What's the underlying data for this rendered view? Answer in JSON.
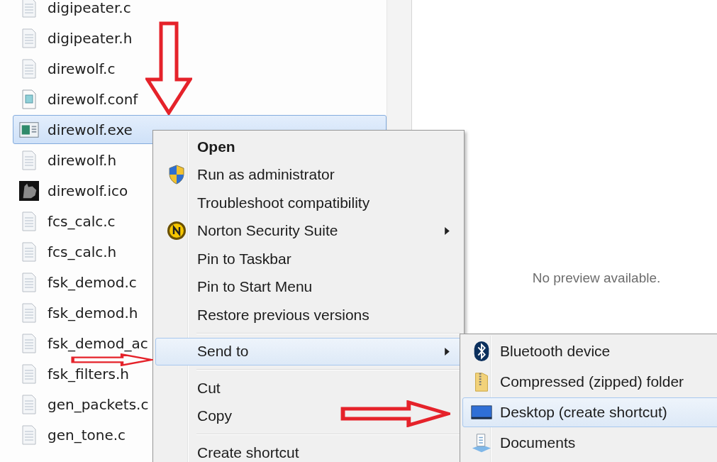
{
  "files": [
    {
      "name": "digipeater.c",
      "kind": "text",
      "selected": false
    },
    {
      "name": "digipeater.h",
      "kind": "text",
      "selected": false
    },
    {
      "name": "direwolf.c",
      "kind": "text",
      "selected": false
    },
    {
      "name": "direwolf.conf",
      "kind": "config",
      "selected": false
    },
    {
      "name": "direwolf.exe",
      "kind": "exe",
      "selected": true
    },
    {
      "name": "direwolf.h",
      "kind": "text",
      "selected": false
    },
    {
      "name": "direwolf.ico",
      "kind": "ico",
      "selected": false
    },
    {
      "name": "fcs_calc.c",
      "kind": "text",
      "selected": false
    },
    {
      "name": "fcs_calc.h",
      "kind": "text",
      "selected": false
    },
    {
      "name": "fsk_demod.c",
      "kind": "text",
      "selected": false
    },
    {
      "name": "fsk_demod.h",
      "kind": "text",
      "selected": false
    },
    {
      "name": "fsk_demod_ac",
      "kind": "text",
      "selected": false
    },
    {
      "name": "fsk_filters.h",
      "kind": "text",
      "selected": false
    },
    {
      "name": "gen_packets.c",
      "kind": "text",
      "selected": false
    },
    {
      "name": "gen_tone.c",
      "kind": "text",
      "selected": false
    }
  ],
  "preview": {
    "message": "No preview available."
  },
  "context_menu": {
    "groups": [
      [
        {
          "label": "Open",
          "default": true,
          "kind": "plain",
          "has_submenu": false,
          "selected": false
        },
        {
          "label": "Run as administrator",
          "default": false,
          "kind": "shield",
          "has_submenu": false,
          "selected": false
        },
        {
          "label": "Troubleshoot compatibility",
          "default": false,
          "kind": "plain",
          "has_submenu": false,
          "selected": false
        },
        {
          "label": "Norton Security Suite",
          "default": false,
          "kind": "norton",
          "has_submenu": true,
          "selected": false
        },
        {
          "label": "Pin to Taskbar",
          "default": false,
          "kind": "plain",
          "has_submenu": false,
          "selected": false
        },
        {
          "label": "Pin to Start Menu",
          "default": false,
          "kind": "plain",
          "has_submenu": false,
          "selected": false
        },
        {
          "label": "Restore previous versions",
          "default": false,
          "kind": "plain",
          "has_submenu": false,
          "selected": false
        }
      ],
      [
        {
          "label": "Send to",
          "default": false,
          "kind": "plain",
          "has_submenu": true,
          "selected": true
        }
      ],
      [
        {
          "label": "Cut",
          "default": false,
          "kind": "plain",
          "has_submenu": false,
          "selected": false
        },
        {
          "label": "Copy",
          "default": false,
          "kind": "plain",
          "has_submenu": false,
          "selected": false
        }
      ],
      [
        {
          "label": "Create shortcut",
          "default": false,
          "kind": "plain",
          "has_submenu": false,
          "selected": false
        }
      ]
    ]
  },
  "send_to_menu": {
    "items": [
      {
        "label": "Bluetooth device",
        "kind": "bluetooth",
        "selected": false
      },
      {
        "label": "Compressed (zipped) folder",
        "kind": "zip",
        "selected": false
      },
      {
        "label": "Desktop (create shortcut)",
        "kind": "desktop",
        "selected": true
      },
      {
        "label": "Documents",
        "kind": "documents",
        "selected": false
      }
    ]
  },
  "annotation_arrows": [
    {
      "kind": "down"
    },
    {
      "kind": "right"
    },
    {
      "kind": "right"
    }
  ]
}
